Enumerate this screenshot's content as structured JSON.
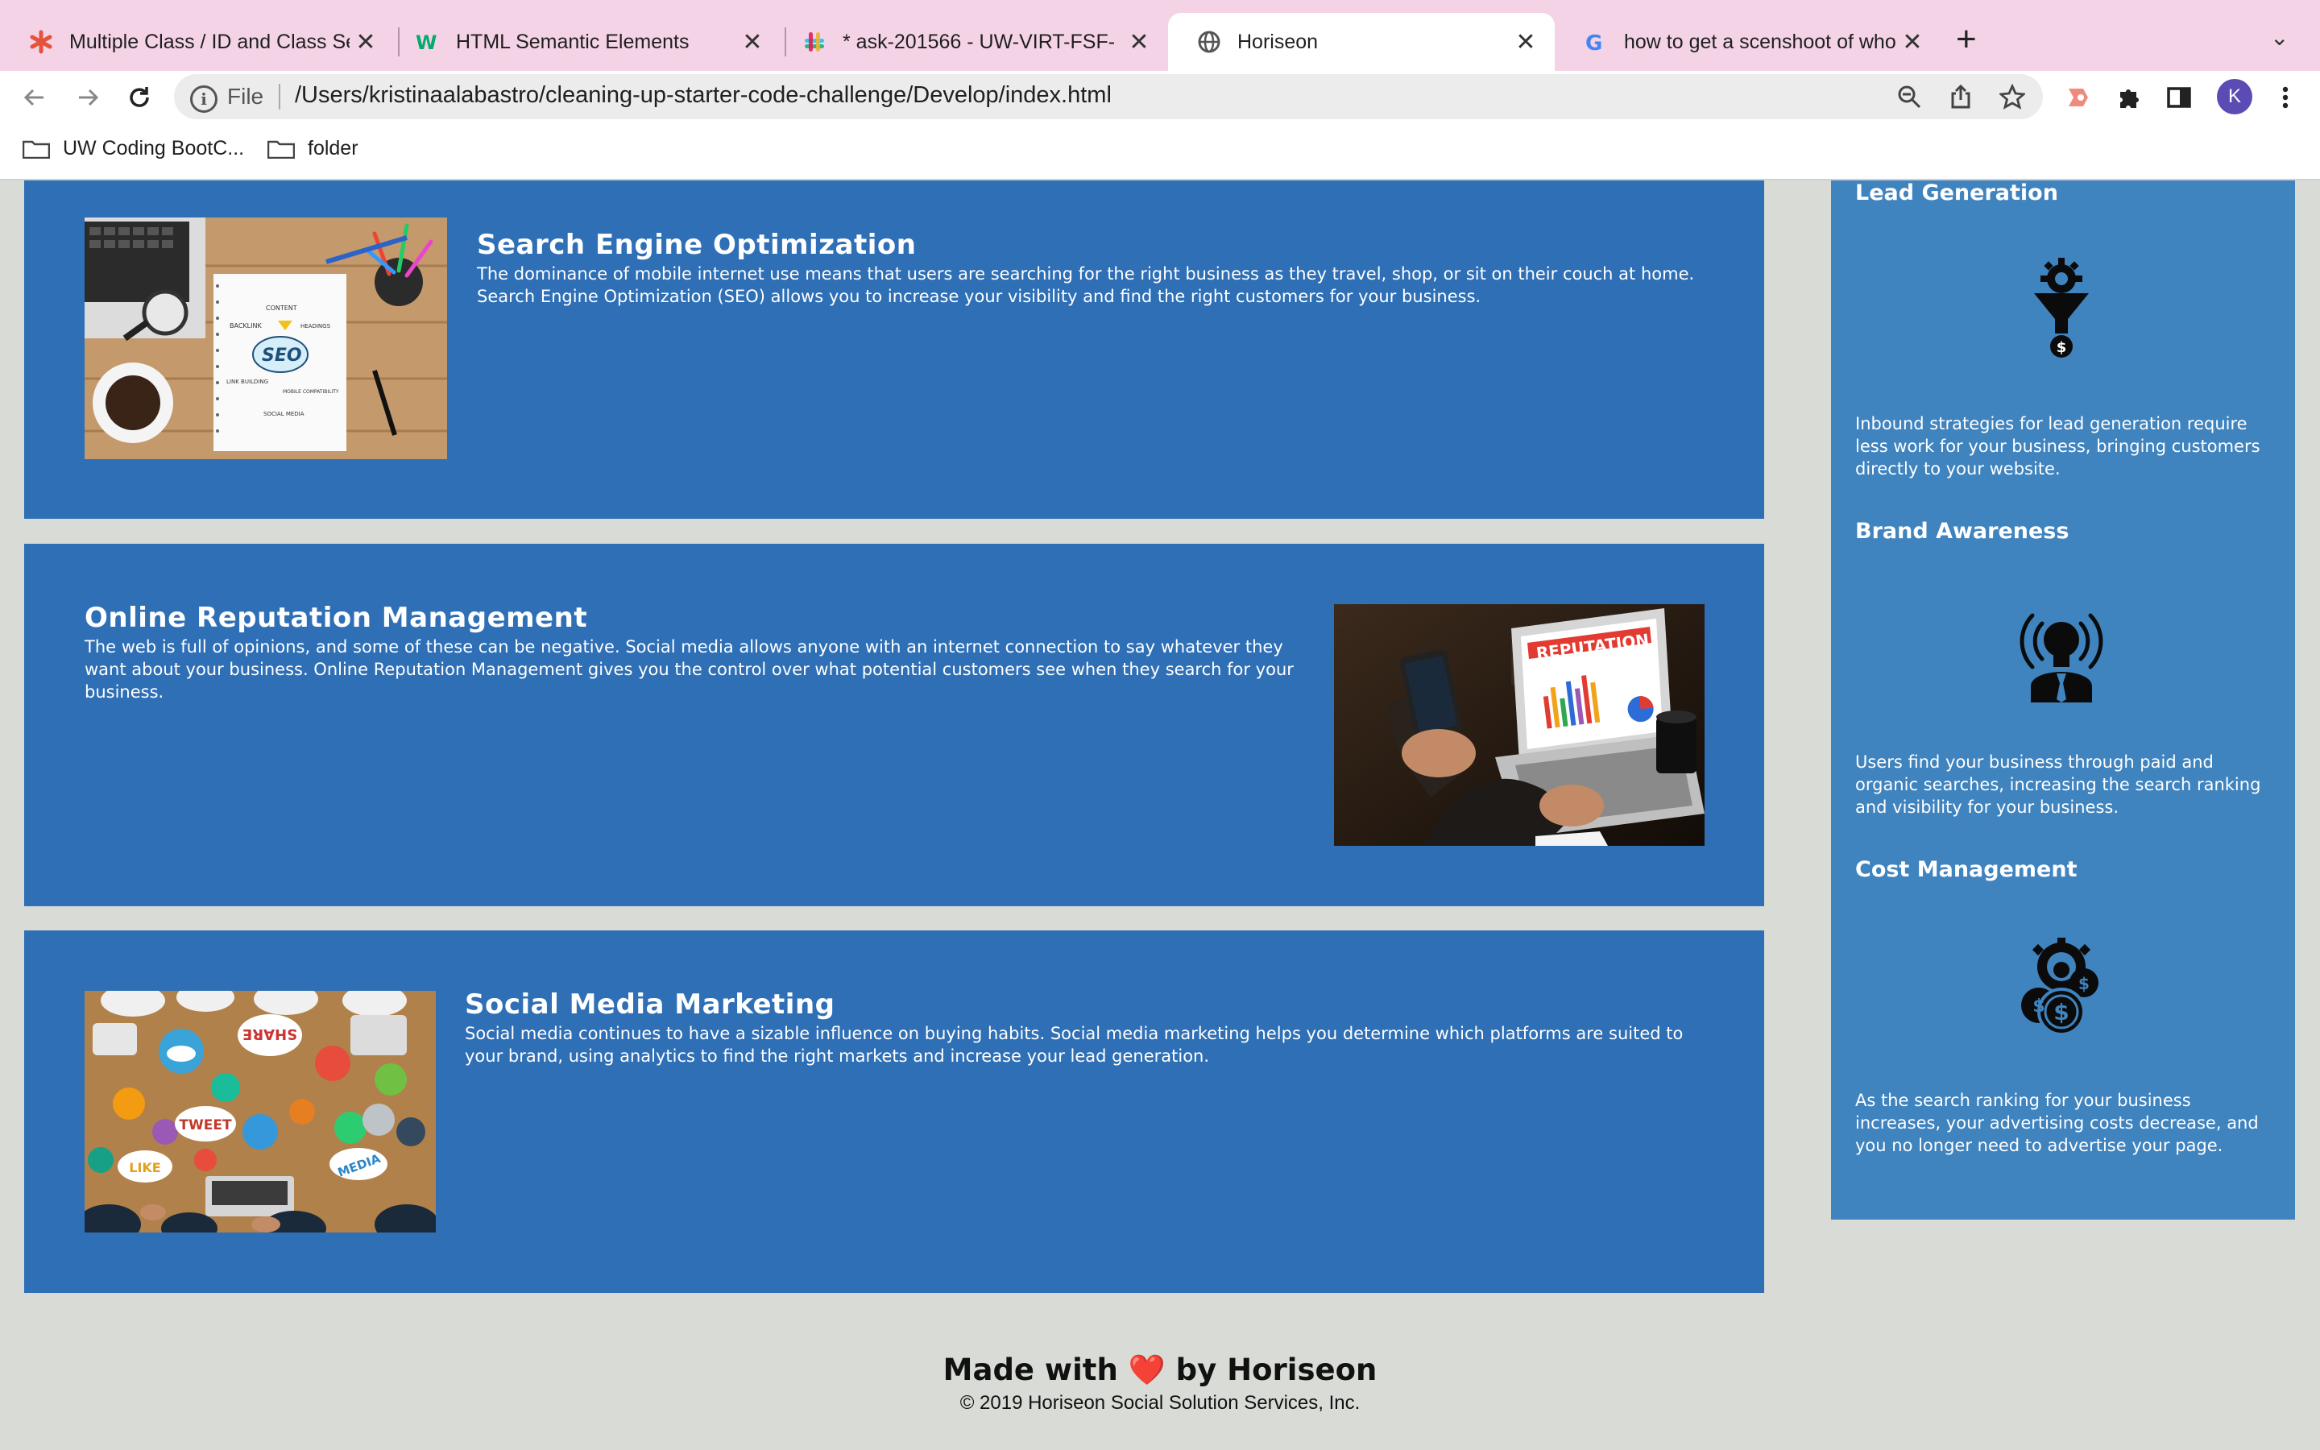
{
  "browser": {
    "tabs": [
      {
        "title": "Multiple Class / ID and Class Se",
        "icon": "asterisk-icon",
        "active": false
      },
      {
        "title": "HTML Semantic Elements",
        "icon": "w3schools-icon",
        "active": false
      },
      {
        "title": "* ask-201566 - UW-VIRT-FSF-",
        "icon": "slack-icon",
        "active": false
      },
      {
        "title": "Horiseon",
        "icon": "globe-icon",
        "active": true
      },
      {
        "title": "how to get a scenshoot of who",
        "icon": "google-icon",
        "active": false
      }
    ],
    "address_scheme": "File",
    "address_url": "/Users/kristinaalabastro/cleaning-up-starter-code-challenge/Develop/index.html",
    "profile_initial": "K",
    "bookmarks": [
      {
        "label": "UW Coding BootC..."
      },
      {
        "label": "folder"
      }
    ]
  },
  "main": {
    "sections": [
      {
        "title": "Search Engine Optimization",
        "text": "The dominance of mobile internet use means that users are searching for the right business as they travel, shop, or sit on their couch at home. Search Engine Optimization (SEO) allows you to increase your visibility and find the right customers for your business."
      },
      {
        "title": "Online Reputation Management",
        "text": "The web is full of opinions, and some of these can be negative. Social media allows anyone with an internet connection to say whatever they want about your business. Online Reputation Management gives you the control over what potential customers see when they search for your business."
      },
      {
        "title": "Social Media Marketing",
        "text": "Social media continues to have a sizable influence on buying habits. Social media marketing helps you determine which platforms are suited to your brand, using analytics to find the right markets and increase your lead generation."
      }
    ],
    "image_text": {
      "seo": "SEO",
      "seo_notes": [
        "CONTENT",
        "BACKLINK",
        "HEADINGS",
        "LINK BUILDING",
        "MOBILE COMPATIBILITY",
        "SOCIAL MEDIA"
      ],
      "reputation": "REPUTATION",
      "social": [
        "SHARE",
        "TWEET",
        "LIKE",
        "MEDIA"
      ]
    }
  },
  "aside": {
    "items": [
      {
        "title": "Lead Generation",
        "icon": "lead-generation-icon",
        "text": "Inbound strategies for lead generation require less work for your business, bringing customers directly to your website."
      },
      {
        "title": "Brand Awareness",
        "icon": "brand-awareness-icon",
        "text": "Users find your business through paid and organic searches, increasing the search ranking and visibility for your business."
      },
      {
        "title": "Cost Management",
        "icon": "cost-management-icon",
        "text": "As the search ranking for your business increases, your advertising costs decrease, and you no longer need to advertise your page."
      }
    ]
  },
  "footer": {
    "made_with": "Made with",
    "heart": "❤️",
    "by": "by Horiseon",
    "copyright": "© 2019 Horiseon Social Solution Services, Inc."
  },
  "colors": {
    "card_blue": "#2e6fb6",
    "aside_blue": "#3f83bf",
    "page_bg": "#d9dcd6",
    "tabstrip_pink": "#f4d3e6"
  }
}
